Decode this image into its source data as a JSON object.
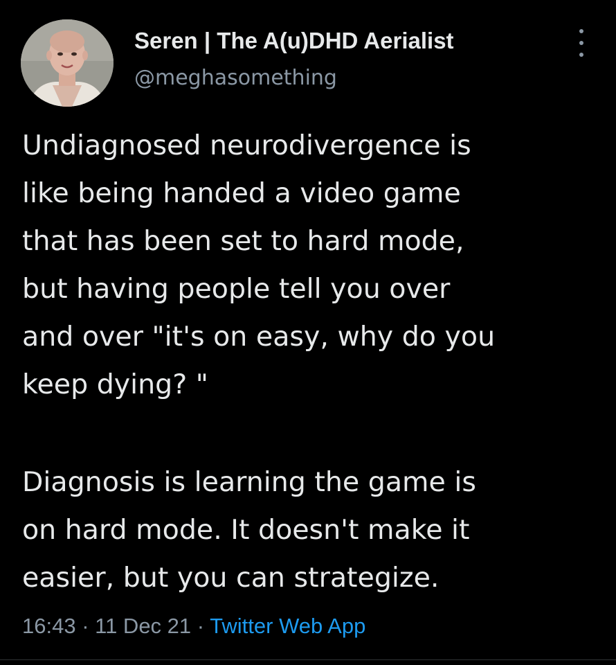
{
  "tweet": {
    "author": {
      "name": "Seren | The A(u)DHD Aerialist",
      "handle": "@meghasomething"
    },
    "body": {
      "paragraph_1": "Undiagnosed neurodivergence is\nlike being handed a video game\nthat has been set to hard mode,\nbut having people tell you over\nand over \"it's on easy, why do you\nkeep dying? \"",
      "paragraph_2": "Diagnosis is learning the game is\non hard mode. It doesn't make it\neasier, but you can strategize."
    },
    "meta": {
      "time": "16:43",
      "date": "11 Dec 21",
      "separator": "·",
      "source": "Twitter Web App"
    },
    "icons": {
      "avatar": "profile-photo",
      "more": "more-options-icon"
    },
    "colors": {
      "background": "#000000",
      "text": "#e7e9ea",
      "secondary": "#8b98a5",
      "link": "#1d9bf0"
    }
  }
}
